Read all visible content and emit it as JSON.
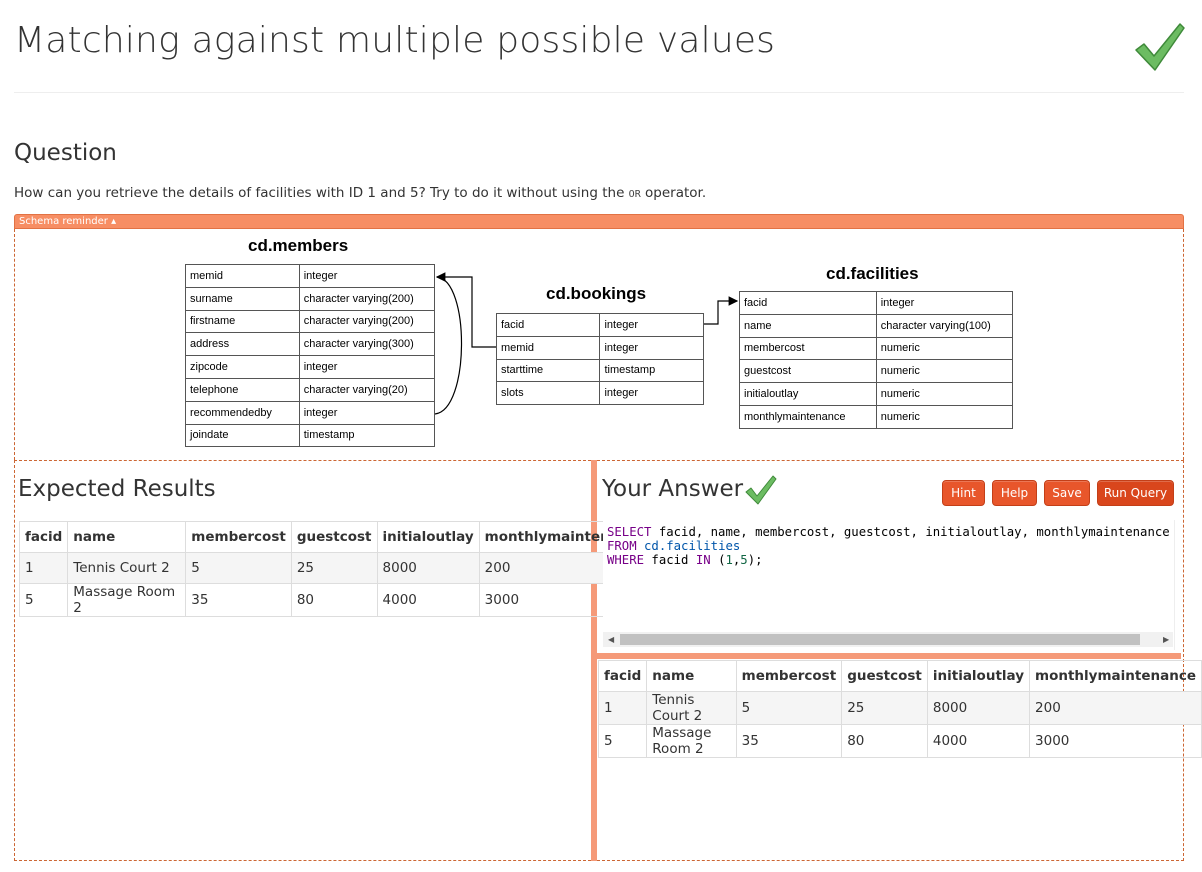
{
  "title": "Matching against multiple possible values",
  "question": {
    "heading": "Question",
    "text_before": "How can you retrieve the details of facilities with ID 1 and 5? Try to do it without using the ",
    "code_word": "OR",
    "text_after": " operator."
  },
  "schema": {
    "toggle_label": "Schema reminder ▴",
    "members": {
      "title": "cd.members",
      "rows": [
        [
          "memid",
          "integer"
        ],
        [
          "surname",
          "character varying(200)"
        ],
        [
          "firstname",
          "character varying(200)"
        ],
        [
          "address",
          "character varying(300)"
        ],
        [
          "zipcode",
          "integer"
        ],
        [
          "telephone",
          "character varying(20)"
        ],
        [
          "recommendedby",
          "integer"
        ],
        [
          "joindate",
          "timestamp"
        ]
      ]
    },
    "bookings": {
      "title": "cd.bookings",
      "rows": [
        [
          "facid",
          "integer"
        ],
        [
          "memid",
          "integer"
        ],
        [
          "starttime",
          "timestamp"
        ],
        [
          "slots",
          "integer"
        ]
      ]
    },
    "facilities": {
      "title": "cd.facilities",
      "rows": [
        [
          "facid",
          "integer"
        ],
        [
          "name",
          "character varying(100)"
        ],
        [
          "membercost",
          "numeric"
        ],
        [
          "guestcost",
          "numeric"
        ],
        [
          "initialoutlay",
          "numeric"
        ],
        [
          "monthlymaintenance",
          "numeric"
        ]
      ]
    }
  },
  "expected": {
    "heading": "Expected Results",
    "columns": [
      "facid",
      "name",
      "membercost",
      "guestcost",
      "initialoutlay",
      "monthlymaintenance"
    ],
    "rows": [
      [
        "1",
        "Tennis Court 2",
        "5",
        "25",
        "8000",
        "200"
      ],
      [
        "5",
        "Massage Room 2",
        "35",
        "80",
        "4000",
        "3000"
      ]
    ]
  },
  "answer": {
    "heading": "Your Answer",
    "buttons": {
      "hint": "Hint",
      "help": "Help",
      "save": "Save",
      "run": "Run Query"
    },
    "code": {
      "l1_kw": "SELECT",
      "l1_rest": " facid, name, membercost, guestcost, initialoutlay, monthlymaintenance",
      "l2_kw": "FROM",
      "l2_var": "cd.facilities",
      "l3_kw": "WHERE",
      "l3_mid": " facid ",
      "l3_in": "IN",
      "l3_open": " (",
      "l3_n1": "1",
      "l3_comma": ",",
      "l3_n2": "5",
      "l3_close": ");"
    },
    "columns": [
      "facid",
      "name",
      "membercost",
      "guestcost",
      "initialoutlay",
      "monthlymaintenance"
    ],
    "rows": [
      [
        "1",
        "Tennis Court 2",
        "5",
        "25",
        "8000",
        "200"
      ],
      [
        "5",
        "Massage Room 2",
        "35",
        "80",
        "4000",
        "3000"
      ]
    ]
  },
  "colors": {
    "accent": "#e8562b",
    "splitter": "#f59a79",
    "check": "#5cb85c"
  }
}
